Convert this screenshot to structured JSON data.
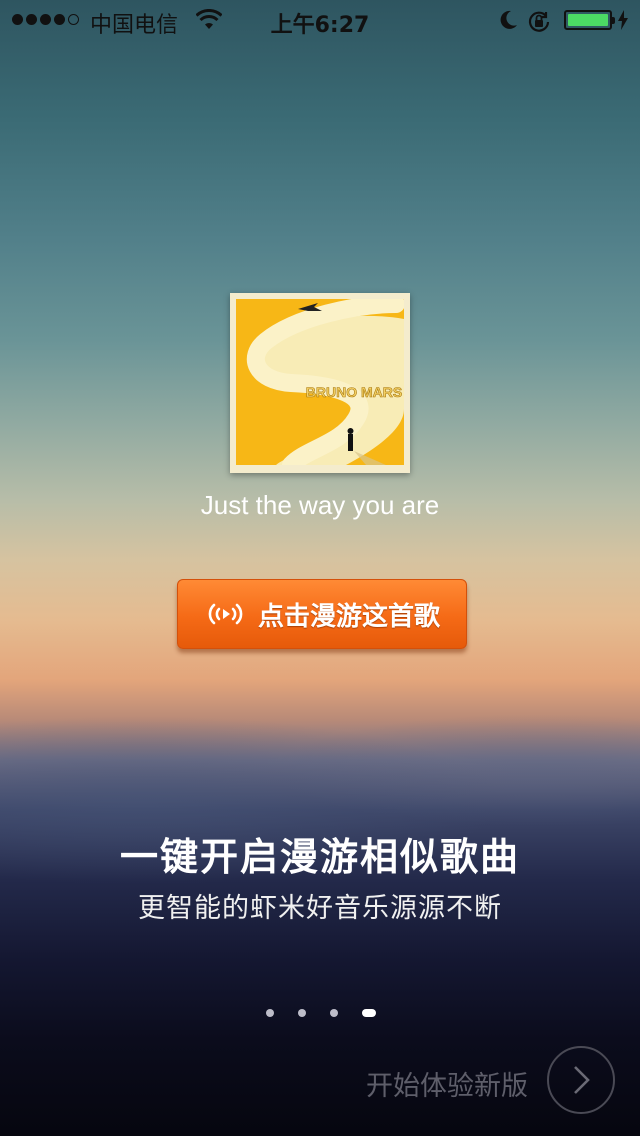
{
  "status_bar": {
    "carrier": "中国电信",
    "time": "上午6:27",
    "signal_bars_filled": 4,
    "signal_bars_total": 5,
    "battery_level": 1.0,
    "battery_color": "#4cd964"
  },
  "song": {
    "album_art_label": "BRUNO MARS",
    "title": "Just the way you are"
  },
  "roam_button": {
    "label": "点击漫游这首歌",
    "icon": "radio-waves-icon",
    "color": "#f56a16"
  },
  "intro": {
    "headline": "一键开启漫游相似歌曲",
    "subline": "更智能的虾米好音乐源源不断"
  },
  "pager": {
    "pages": 4,
    "current": 4
  },
  "start": {
    "label": "开始体验新版",
    "icon": "chevron-right-icon"
  }
}
